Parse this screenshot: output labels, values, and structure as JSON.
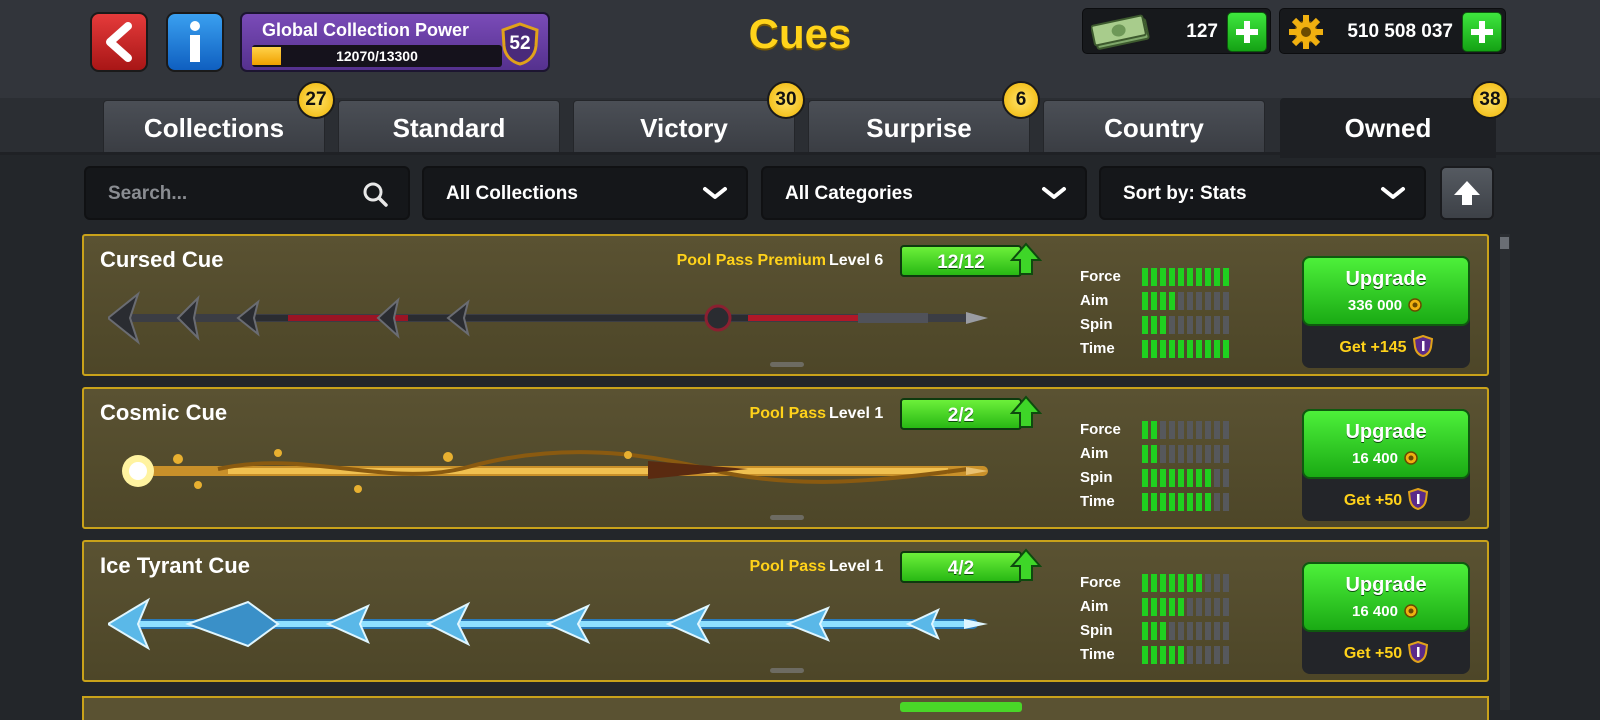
{
  "header": {
    "back_icon": "back-arrow-icon",
    "info_icon": "info-icon",
    "title": "Cues",
    "collection_power": {
      "label": "Global Collection Power",
      "current": 12070,
      "max": 13300,
      "display": "12070/13300",
      "level": "52"
    },
    "cash": {
      "icon": "cash-icon",
      "value": "127"
    },
    "coins": {
      "icon": "coin-gear-icon",
      "value": "510 508 037"
    }
  },
  "tabs": [
    {
      "label": "Collections",
      "badge": "27",
      "active": false
    },
    {
      "label": "Standard",
      "badge": "",
      "active": false
    },
    {
      "label": "Victory",
      "badge": "30",
      "active": false
    },
    {
      "label": "Surprise",
      "badge": "6",
      "active": false
    },
    {
      "label": "Country",
      "badge": "",
      "active": false
    },
    {
      "label": "Owned",
      "badge": "38",
      "active": true
    }
  ],
  "filters": {
    "search_placeholder": "Search...",
    "collections": "All Collections",
    "categories": "All Categories",
    "sort": "Sort by: Stats"
  },
  "cues": [
    {
      "name": "Cursed Cue",
      "pass": "Pool Pass Premium",
      "level": "Level 6",
      "progress": "12/12",
      "stats": {
        "force": 10,
        "aim": 4,
        "spin": 3,
        "time": 10
      },
      "stat_labels": [
        "Force",
        "Aim",
        "Spin",
        "Time"
      ],
      "upgrade_label": "Upgrade",
      "upgrade_cost": "336 000",
      "reward": "Get +145"
    },
    {
      "name": "Cosmic Cue",
      "pass": "Pool Pass",
      "level": "Level 1",
      "progress": "2/2",
      "stats": {
        "force": 2,
        "aim": 2,
        "spin": 8,
        "time": 8
      },
      "stat_labels": [
        "Force",
        "Aim",
        "Spin",
        "Time"
      ],
      "upgrade_label": "Upgrade",
      "upgrade_cost": "16 400",
      "reward": "Get +50"
    },
    {
      "name": "Ice Tyrant Cue",
      "pass": "Pool Pass",
      "level": "Level 1",
      "progress": "4/2",
      "stats": {
        "force": 7,
        "aim": 5,
        "spin": 3,
        "time": 5
      },
      "stat_labels": [
        "Force",
        "Aim",
        "Spin",
        "Time"
      ],
      "upgrade_label": "Upgrade",
      "upgrade_cost": "16 400",
      "reward": "Get +50"
    }
  ],
  "colors": {
    "accent_gold": "#ffd31a",
    "stat_on": "#1fd01f",
    "stat_off": "#56585c",
    "card_border": "#c9a21a"
  }
}
